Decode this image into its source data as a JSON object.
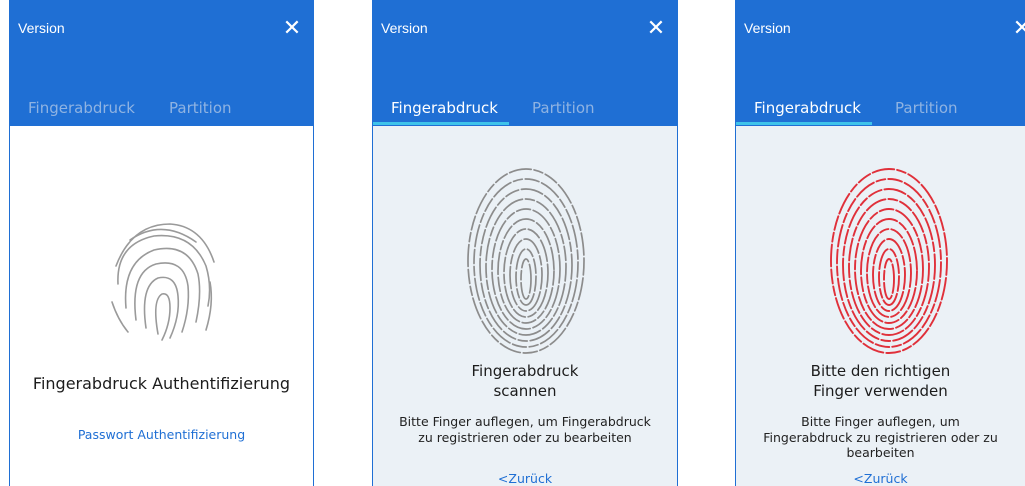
{
  "panels": [
    {
      "window_title": "Version",
      "tabs": [
        {
          "label": "Fingerabdruck"
        },
        {
          "label": "Partition"
        }
      ],
      "message": "Fingerabdruck Authentifizierung",
      "link": "Passwort Authentifizierung"
    },
    {
      "window_title": "Version",
      "tabs": [
        {
          "label": "Fingerabdruck"
        },
        {
          "label": "Partition"
        }
      ],
      "message_line1": "Fingerabdruck",
      "message_line2": "scannen",
      "instruction": "Bitte Finger auflegen, um Fingerabdruck zu registrieren oder zu bearbeiten",
      "back_link": "<Zurück"
    },
    {
      "window_title": "Version",
      "tabs": [
        {
          "label": "Fingerabdruck"
        },
        {
          "label": "Partition"
        }
      ],
      "message_line1": "Bitte den richtigen",
      "message_line2": "Finger verwenden",
      "instruction": "Bitte Finger auflegen, um Fingerabdruck zu registrieren oder zu bearbeiten",
      "back_link": "<Zurück"
    }
  ],
  "icons": {
    "close": "close-icon",
    "fingerprint": "fingerprint-icon"
  },
  "colors": {
    "header": "#1f6fd4",
    "tab_active_underline": "#3ec3ea",
    "fingerprint_idle": "#9a9a9a",
    "fingerprint_scan": "#8c8c8c",
    "fingerprint_error": "#e0303a",
    "link": "#1f6fd4"
  }
}
